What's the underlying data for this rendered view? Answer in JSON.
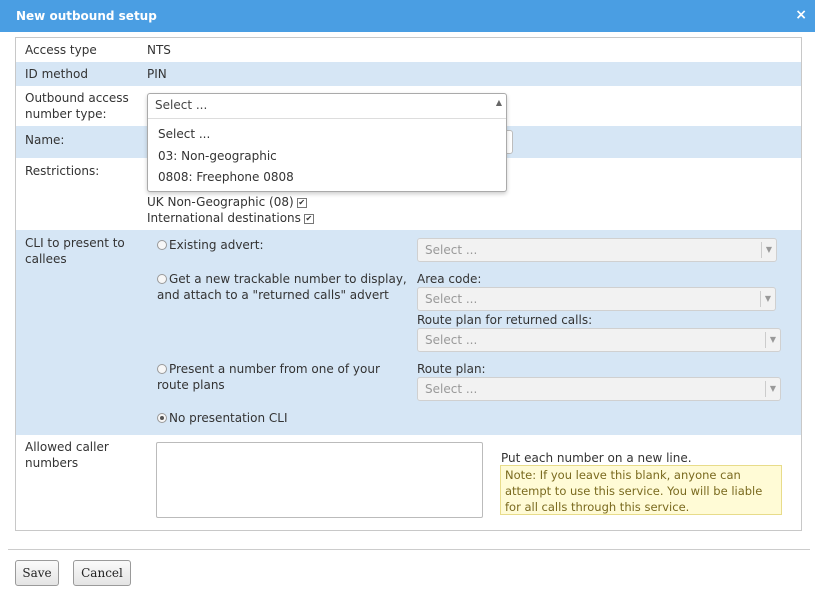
{
  "dialog": {
    "title": "New outbound setup",
    "close_label": "×"
  },
  "fields": {
    "access_type": {
      "label": "Access type",
      "value": "NTS"
    },
    "id_method": {
      "label": "ID method",
      "value": "PIN"
    },
    "outbound_type": {
      "label_line1": "Outbound access",
      "label_line2": "number type:",
      "selected": "Select ...",
      "options": [
        "Select ...",
        "03: Non-geographic",
        "0808: Freephone 0808"
      ]
    },
    "name": {
      "label": "Name:"
    },
    "restrictions": {
      "label": "Restrictions:",
      "items": [
        {
          "label": "UK Non-Geographic (08)",
          "checked": true
        },
        {
          "label": "International destinations",
          "checked": true
        }
      ]
    }
  },
  "cli": {
    "label_line1": "CLI to present to",
    "label_line2": "callees",
    "options": {
      "existing": {
        "label": "Existing advert:",
        "select": "Select ..."
      },
      "trackable": {
        "line1": "Get a new trackable number to display,",
        "line2": "and attach to a \"returned calls\" advert",
        "area_code_label": "Area code:",
        "area_code_select": "Select ...",
        "route_label": "Route plan for returned calls:",
        "route_select": "Select ..."
      },
      "route_plan": {
        "line1": "Present a number from one of your",
        "line2": "route plans",
        "label": "Route plan:",
        "select": "Select ..."
      },
      "none": {
        "label": "No presentation CLI",
        "selected": true
      }
    }
  },
  "allowed": {
    "label_line1": "Allowed caller",
    "label_line2": "numbers",
    "hint": "Put each number on a new line.",
    "note": "Note: If you leave this blank, anyone can attempt to use this service. You will be liable for all calls through this service."
  },
  "buttons": {
    "save": "Save",
    "cancel": "Cancel"
  }
}
